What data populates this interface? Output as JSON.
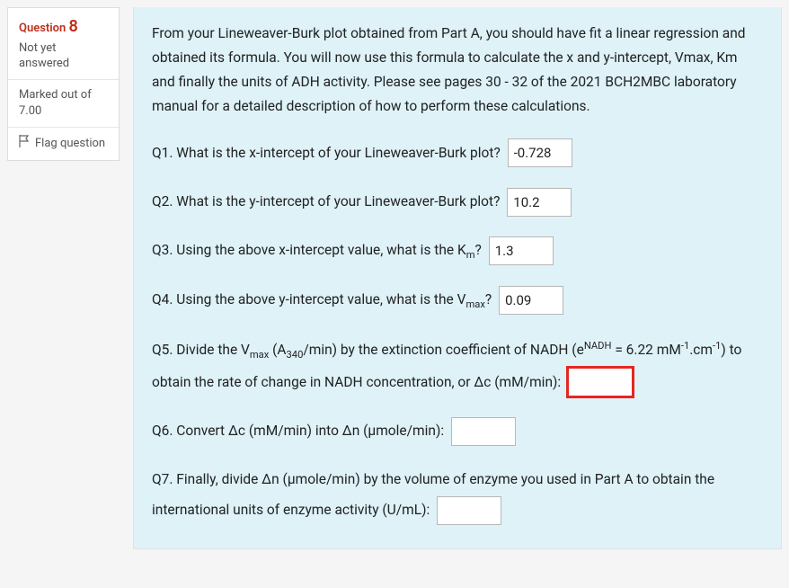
{
  "sidebar": {
    "question_label": "Question",
    "question_number": "8",
    "status": "Not yet answered",
    "marked_label": "Marked out of",
    "marked_value": "7.00",
    "flag_label": "Flag question"
  },
  "content": {
    "intro": "From your Lineweaver-Burk plot obtained from Part A, you should have fit a linear regression and obtained its formula. You will now use this formula to calculate the x and y-intercept, Vmax, Km and finally the units of ADH activity. Please see pages 30 - 32 of the 2021 BCH2MBC laboratory manual for a detailed description of how to perform these calculations.",
    "q1": {
      "text": "Q1. What is the x-intercept of your Lineweaver-Burk plot?",
      "value": "-0.728"
    },
    "q2": {
      "text": "Q2. What is the y-intercept of your Lineweaver-Burk plot?",
      "value": "10.2"
    },
    "q3": {
      "pre": "Q3. Using the above x-intercept value, what is the K",
      "sub": "m",
      "post": "?",
      "value": "1.3"
    },
    "q4": {
      "pre": "Q4. Using the above y-intercept value, what is the V",
      "sub": "max",
      "post": "?",
      "value": "0.09"
    },
    "q5": {
      "p1": "Q5. Divide the V",
      "sub1": "max",
      "p2": " (A",
      "sub2": "340",
      "p3": "/min) by the extinction coefficient of NADH (e",
      "sup1": "NADH",
      "p4": " = 6.22 mM",
      "sup2": "-1",
      "p5": ".cm",
      "sup3": "-1",
      "p6": ") to obtain the rate of change in NADH concentration, or Δc (mM/min):",
      "value": ""
    },
    "q6": {
      "text": "Q6. Convert Δc (mM/min) into Δn (µmole/min):",
      "value": ""
    },
    "q7": {
      "text": "Q7. Finally, divide Δn (µmole/min) by the volume of enzyme you used in Part A to obtain the international units of enzyme activity (U/mL):",
      "value": ""
    }
  }
}
